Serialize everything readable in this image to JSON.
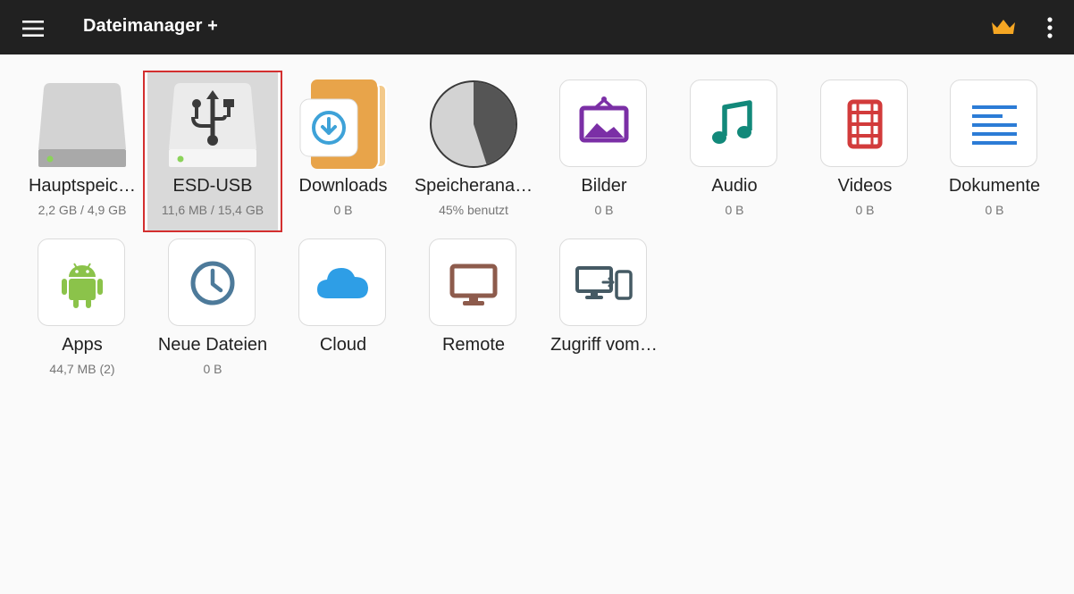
{
  "appbar": {
    "title": "Dateimanager +",
    "menu_icon": "hamburger-menu-icon",
    "premium_icon": "crown-icon",
    "more_icon": "more-vertical-icon"
  },
  "colors": {
    "appbar_bg": "#212121",
    "crown": "#f5a623",
    "selection_border": "#d32f2f",
    "downloads": "#e8a44a",
    "images": "#7b2fa6",
    "audio": "#12897a",
    "videos": "#d23b3b",
    "documents": "#2c7cd6",
    "apps": "#8bc34a",
    "recent": "#4d7a9a",
    "cloud": "#2e9ee6",
    "remote": "#8d5b4c",
    "access": "#455a64"
  },
  "items": [
    {
      "label": "Hauptspeic…",
      "sub": "2,2 GB / 4,9 GB",
      "icon": "internal-storage-icon"
    },
    {
      "label": "ESD-USB",
      "sub": "11,6 MB / 15,4 GB",
      "icon": "usb-drive-icon",
      "selected": true
    },
    {
      "label": "Downloads",
      "sub": "0 B",
      "icon": "downloads-folder-icon"
    },
    {
      "label": "Speicherana…",
      "sub": "45% benutzt",
      "icon": "storage-pie-icon",
      "used_fraction": 0.45
    },
    {
      "label": "Bilder",
      "sub": "0 B",
      "icon": "image-icon"
    },
    {
      "label": "Audio",
      "sub": "0 B",
      "icon": "music-note-icon"
    },
    {
      "label": "Videos",
      "sub": "0 B",
      "icon": "film-icon"
    },
    {
      "label": "Dokumente",
      "sub": "0 B",
      "icon": "document-lines-icon"
    },
    {
      "label": "Apps",
      "sub": "44,7 MB (2)",
      "icon": "android-icon"
    },
    {
      "label": "Neue Dateien",
      "sub": "0 B",
      "icon": "clock-icon"
    },
    {
      "label": "Cloud",
      "sub": "",
      "icon": "cloud-icon"
    },
    {
      "label": "Remote",
      "sub": "",
      "icon": "monitor-icon"
    },
    {
      "label": "Zugriff vom…",
      "sub": "",
      "icon": "devices-icon"
    }
  ]
}
